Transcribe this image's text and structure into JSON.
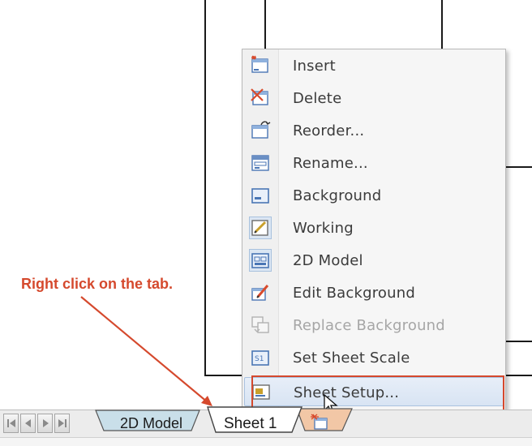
{
  "annotation": {
    "text": "Right click on the tab."
  },
  "context_menu": {
    "items": [
      {
        "label": "Insert",
        "icon": "insert-sheet-icon",
        "state": "normal"
      },
      {
        "label": "Delete",
        "icon": "delete-sheet-icon",
        "state": "normal"
      },
      {
        "label": "Reorder...",
        "icon": "reorder-sheet-icon",
        "state": "normal"
      },
      {
        "label": "Rename...",
        "icon": "rename-sheet-icon",
        "state": "normal"
      },
      {
        "label": "Background",
        "icon": "background-icon",
        "state": "normal"
      },
      {
        "label": "Working",
        "icon": "working-icon",
        "state": "checked"
      },
      {
        "label": "2D Model",
        "icon": "model-2d-icon",
        "state": "checked"
      },
      {
        "label": "Edit Background",
        "icon": "edit-background-icon",
        "state": "normal"
      },
      {
        "label": "Replace Background",
        "icon": "replace-background-icon",
        "state": "disabled"
      },
      {
        "label": "Set Sheet Scale",
        "icon": "sheet-scale-icon",
        "state": "normal"
      },
      {
        "label": "Sheet Setup...",
        "icon": "sheet-setup-icon",
        "state": "hover"
      }
    ]
  },
  "tabs": {
    "items": [
      {
        "label": "2D Model"
      },
      {
        "label": "Sheet 1",
        "active": true
      }
    ],
    "new_tab_icon": "new-sheet-tab-icon"
  },
  "colors": {
    "annotation": "#d5492d",
    "tab_model": "#c9dfe9",
    "tab_new": "#f2c7a6"
  }
}
